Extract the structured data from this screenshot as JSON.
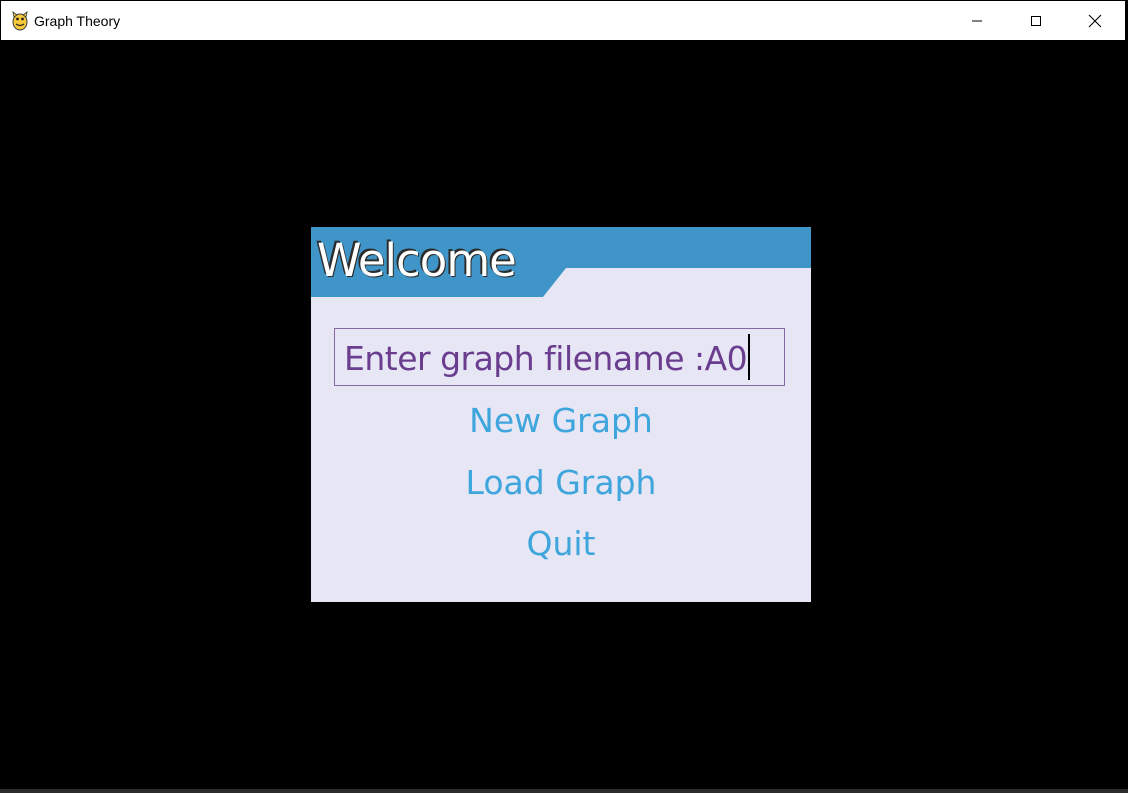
{
  "window": {
    "title": "Graph Theory",
    "app_icon": "python-icon",
    "controls": [
      "minimize-icon",
      "maximize-icon",
      "close-icon"
    ]
  },
  "dialog": {
    "title": "Welcome",
    "header_color": "#3f95c8",
    "panel_color": "#e6e6f5",
    "input": {
      "label": "Enter graph filename :",
      "value": "A0",
      "text_color": "#6a3d8f"
    },
    "menu": [
      {
        "label": "New Graph"
      },
      {
        "label": "Load Graph"
      },
      {
        "label": "Quit"
      }
    ],
    "menu_color": "#3ea6dc"
  }
}
